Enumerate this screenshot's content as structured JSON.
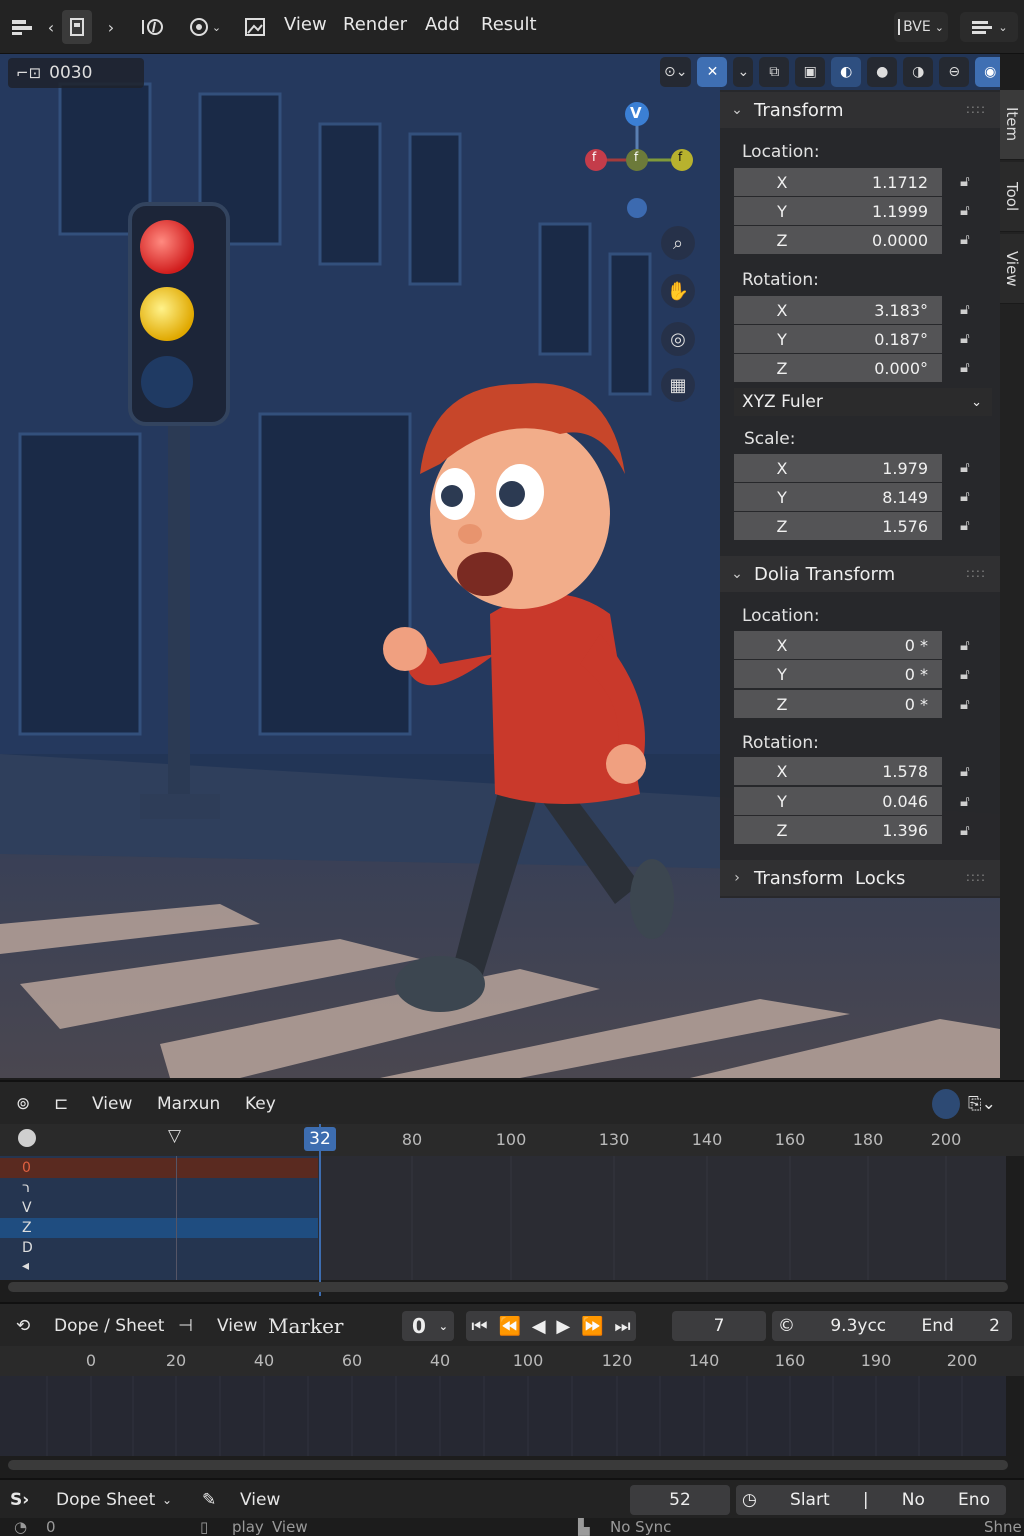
{
  "header": {
    "menus": [
      "View",
      "Render",
      "Add",
      "Result"
    ],
    "engine_label": "BVE"
  },
  "viewport": {
    "frame_value": "0030",
    "gizmo_axes": {
      "top": "V",
      "left": "f",
      "center": "f",
      "right": "f"
    }
  },
  "sidebar_tabs": [
    "Item",
    "Tool",
    "View"
  ],
  "transform_panel": {
    "title": "Transform",
    "location_label": "Location:",
    "location": [
      {
        "axis": "X",
        "value": "1.1712"
      },
      {
        "axis": "Y",
        "value": "1.1999"
      },
      {
        "axis": "Z",
        "value": "0.0000"
      }
    ],
    "rotation_label": "Rotation:",
    "rotation": [
      {
        "axis": "X",
        "value": "3.183°"
      },
      {
        "axis": "Y",
        "value": "0.187°"
      },
      {
        "axis": "Z",
        "value": "0.000°"
      }
    ],
    "rotation_mode": "XYZ Fuler",
    "scale_label": "Scale:",
    "scale": [
      {
        "axis": "X",
        "value": "1.979"
      },
      {
        "axis": "Y",
        "value": "8.149"
      },
      {
        "axis": "Z",
        "value": "1.576"
      }
    ]
  },
  "delta_panel": {
    "title": "Dolia Transform",
    "location_label": "Location:",
    "location": [
      {
        "axis": "X",
        "value": "0 *"
      },
      {
        "axis": "Y",
        "value": "0 *"
      },
      {
        "axis": "Z",
        "value": "0 *"
      }
    ],
    "rotation_label": "Rotation:",
    "rotation": [
      {
        "axis": "X",
        "value": "1.578"
      },
      {
        "axis": "Y",
        "value": "0.046"
      },
      {
        "axis": "Z",
        "value": "1.396"
      }
    ]
  },
  "locks_panel": {
    "title": "Transform  Locks"
  },
  "timeline": {
    "menus": [
      "View",
      "Marxun",
      "Key"
    ],
    "current_frame": "32",
    "ticks": [
      "80",
      "100",
      "130",
      "140",
      "160",
      "180",
      "200"
    ],
    "channels": [
      "0",
      "ר",
      "V",
      "Z",
      "D",
      "◂"
    ]
  },
  "dopesheet": {
    "editor_label": "Dope / Sheet",
    "view_label": "View",
    "marker_label": "Marker",
    "frame_value": "0",
    "current_field": "7",
    "fps_field": "9.3ycc",
    "end_label": "End",
    "end_value": "2",
    "ticks": [
      "0",
      "20",
      "40",
      "60",
      "40",
      "100",
      "120",
      "140",
      "160",
      "190",
      "200"
    ]
  },
  "bottom_bar": {
    "editor_label": "Dope Sheet",
    "view_label": "View",
    "frame_field": "52",
    "start_label": "Slart",
    "no_label": "No",
    "end_label": "Eno"
  },
  "status_bar": {
    "left_value": "0",
    "play_label": "play",
    "view_label": "View",
    "sync_label": "No Sync",
    "right_label": "Shne"
  },
  "colors": {
    "accent": "#3f6fb3",
    "playhead": "#3d6db0",
    "panel": "#303032"
  }
}
